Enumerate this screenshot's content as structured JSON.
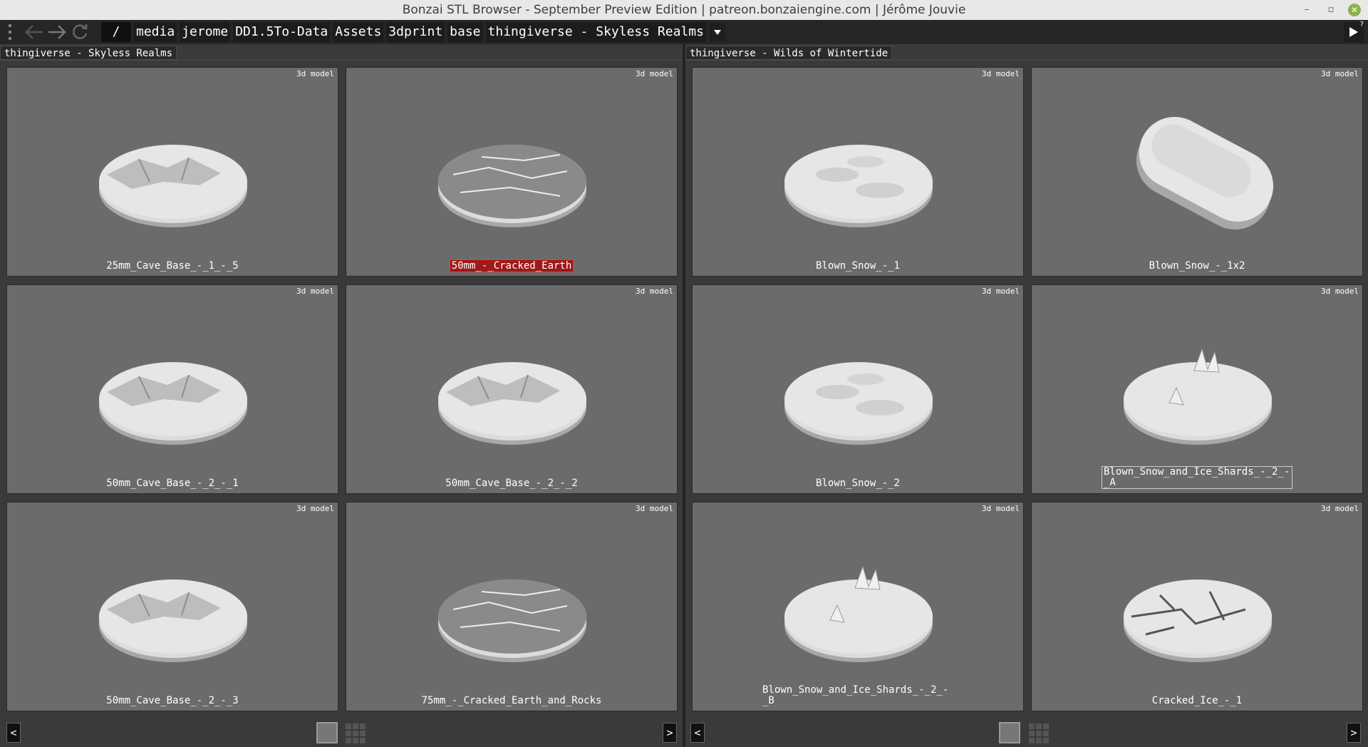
{
  "window": {
    "title": "Bonzai STL Browser - September Preview Edition | patreon.bonzaiengine.com | Jérôme Jouvie",
    "controls": [
      "–",
      "▫",
      "✕"
    ]
  },
  "toolbar": {
    "root": "/",
    "breadcrumbs": [
      "media",
      "jerome",
      "DD1.5To-Data",
      "Assets",
      "3dprint",
      "base",
      "thingiverse - Skyless Realms"
    ],
    "dropdown_glyph": "▾",
    "play_badge": "?"
  },
  "left_pane": {
    "tab": "thingiverse - Skyless Realms",
    "prev": "<",
    "next": ">",
    "items": [
      {
        "tag": "3d model",
        "name": "25mm_Cave_Base_-_1_-_5",
        "style": "cave"
      },
      {
        "tag": "3d model",
        "name": "50mm_-_Cracked_Earth",
        "style": "cracked",
        "selected": true
      },
      {
        "tag": "3d model",
        "name": "50mm_Cave_Base_-_2_-_1",
        "style": "rocks"
      },
      {
        "tag": "3d model",
        "name": "50mm_Cave_Base_-_2_-_2",
        "style": "rocks"
      },
      {
        "tag": "3d model",
        "name": "50mm_Cave_Base_-_2_-_3",
        "style": "cave"
      },
      {
        "tag": "3d model",
        "name": "75mm_-_Cracked_Earth_and_Rocks",
        "style": "cracked"
      }
    ]
  },
  "right_pane": {
    "tab": "thingiverse - Wilds of Wintertide",
    "prev": "<",
    "next": ">",
    "items": [
      {
        "tag": "3d model",
        "name": "Blown_Snow_-_1",
        "style": "snow"
      },
      {
        "tag": "3d model",
        "name": "Blown_Snow_-_1x2",
        "style": "oval"
      },
      {
        "tag": "3d model",
        "name": "Blown_Snow_-_2",
        "style": "snow"
      },
      {
        "tag": "3d model",
        "name": "Blown_Snow_and_Ice_Shards_-_2_-_A",
        "style": "shards",
        "boxed": true
      },
      {
        "tag": "3d model",
        "name": "Blown_Snow_and_Ice_Shards_-_2_-_B",
        "style": "shards",
        "wrapped": true
      },
      {
        "tag": "3d model",
        "name": "Cracked_Ice_-_1",
        "style": "ice"
      }
    ]
  },
  "colors": {
    "card_bg": "#6b6b6b",
    "selection": "#a01818",
    "model_light": "#e6e6e6",
    "model_shadow": "#a8a8a8"
  }
}
